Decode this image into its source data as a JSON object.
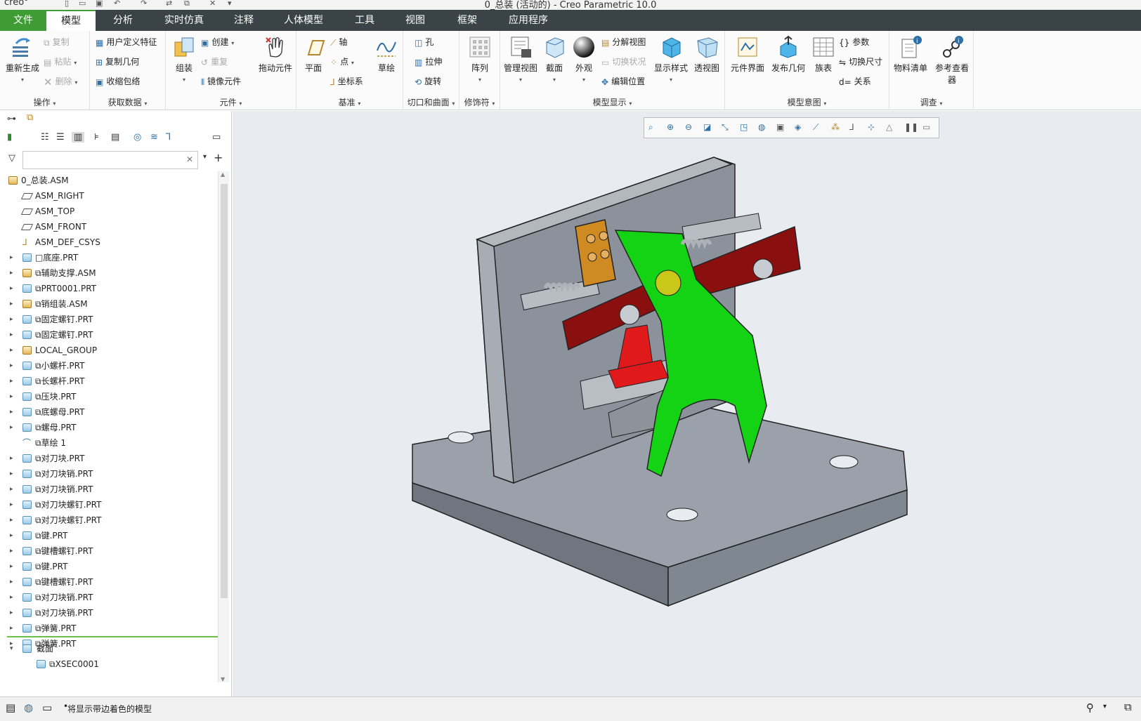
{
  "title": "0_总装 (活动的) - Creo Parametric 10.0",
  "app_logo": "creo°",
  "tabs": [
    "文件",
    "模型",
    "分析",
    "实时仿真",
    "注释",
    "人体模型",
    "工具",
    "视图",
    "框架",
    "应用程序"
  ],
  "ribbon": {
    "operations": {
      "regen": "重新生成",
      "copy": "复制",
      "paste": "粘贴",
      "delete": "删除",
      "title": "操作"
    },
    "get_data": {
      "udf": "用户定义特征",
      "copy_geom": "复制几何",
      "shrinkwrap": "收缩包络",
      "title": "获取数据"
    },
    "component": {
      "assemble": "组装",
      "create": "创建",
      "repeat": "重复",
      "mirror": "镜像元件",
      "drag": "拖动元件",
      "title": "元件"
    },
    "datum": {
      "plane": "平面",
      "axis": "轴",
      "point": "点",
      "csys": "坐标系",
      "sketch": "草绘",
      "title": "基准"
    },
    "cut_surface": {
      "hole": "孔",
      "extrude": "拉伸",
      "revolve": "旋转",
      "title": "切口和曲面"
    },
    "modifiers": {
      "pattern": "阵列",
      "title": "修饰符"
    },
    "model_display": {
      "manage_views": "管理视图",
      "section": "截面",
      "appearance": "外观",
      "explode": "分解视图",
      "toggle_status": "切换状况",
      "edit_position": "编辑位置",
      "display_style": "显示样式",
      "perspective": "透视图",
      "title": "模型显示"
    },
    "model_intent": {
      "comp_interface": "元件界面",
      "publish_geom": "发布几何",
      "family_table": "族表",
      "params": "参数",
      "switch_dims": "切换尺寸",
      "relations": "关系",
      "title": "模型意图"
    },
    "investigate": {
      "bom": "物料清单",
      "ref_viewer": "参考查看器",
      "title": "调查"
    }
  },
  "tree": [
    {
      "label": "0_总装.ASM",
      "icon": "asm-icon",
      "level": 0,
      "expand": ""
    },
    {
      "label": "ASM_RIGHT",
      "icon": "plane-icon",
      "level": 1,
      "expand": ""
    },
    {
      "label": "ASM_TOP",
      "icon": "plane-icon",
      "level": 1,
      "expand": ""
    },
    {
      "label": "ASM_FRONT",
      "icon": "plane-icon",
      "level": 1,
      "expand": ""
    },
    {
      "label": "ASM_DEF_CSYS",
      "icon": "csys-icon",
      "level": 1,
      "expand": ""
    },
    {
      "label": "□底座.PRT",
      "icon": "part-icon",
      "level": 1,
      "expand": "▸"
    },
    {
      "label": "⧉辅助支撑.ASM",
      "icon": "asm-icon",
      "level": 1,
      "expand": "▸"
    },
    {
      "label": "⧉PRT0001.PRT",
      "icon": "part-icon",
      "level": 1,
      "expand": "▸"
    },
    {
      "label": "⧉销组装.ASM",
      "icon": "asm-icon",
      "level": 1,
      "expand": "▸"
    },
    {
      "label": "⧉固定螺钉.PRT",
      "icon": "part-icon",
      "level": 1,
      "expand": "▸"
    },
    {
      "label": "⧉固定螺钉.PRT",
      "icon": "part-icon",
      "level": 1,
      "expand": "▸"
    },
    {
      "label": "LOCAL_GROUP",
      "icon": "group-icon",
      "level": 1,
      "expand": "▸"
    },
    {
      "label": "⧉小螺杆.PRT",
      "icon": "part-icon",
      "level": 1,
      "expand": "▸"
    },
    {
      "label": "⧉长螺杆.PRT",
      "icon": "part-icon",
      "level": 1,
      "expand": "▸"
    },
    {
      "label": "⧉压块.PRT",
      "icon": "part-icon",
      "level": 1,
      "expand": "▸"
    },
    {
      "label": "⧉底螺母.PRT",
      "icon": "part-icon",
      "level": 1,
      "expand": "▸"
    },
    {
      "label": "⧉螺母.PRT",
      "icon": "part-icon",
      "level": 1,
      "expand": "▸"
    },
    {
      "label": "⧉草绘 1",
      "icon": "sketch-icon",
      "level": 1,
      "expand": ""
    },
    {
      "label": "⧉对刀块.PRT",
      "icon": "part-icon",
      "level": 1,
      "expand": "▸"
    },
    {
      "label": "⧉对刀块销.PRT",
      "icon": "part-icon",
      "level": 1,
      "expand": "▸"
    },
    {
      "label": "⧉对刀块销.PRT",
      "icon": "part-icon",
      "level": 1,
      "expand": "▸"
    },
    {
      "label": "⧉对刀块螺钉.PRT",
      "icon": "part-icon",
      "level": 1,
      "expand": "▸"
    },
    {
      "label": "⧉对刀块螺钉.PRT",
      "icon": "part-icon",
      "level": 1,
      "expand": "▸"
    },
    {
      "label": "⧉键.PRT",
      "icon": "part-icon",
      "level": 1,
      "expand": "▸"
    },
    {
      "label": "⧉键槽螺钉.PRT",
      "icon": "part-icon",
      "level": 1,
      "expand": "▸"
    },
    {
      "label": "⧉键.PRT",
      "icon": "part-icon",
      "level": 1,
      "expand": "▸"
    },
    {
      "label": "⧉键槽螺钉.PRT",
      "icon": "part-icon",
      "level": 1,
      "expand": "▸"
    },
    {
      "label": "⧉对刀块销.PRT",
      "icon": "part-icon",
      "level": 1,
      "expand": "▸"
    },
    {
      "label": "⧉对刀块销.PRT",
      "icon": "part-icon",
      "level": 1,
      "expand": "▸"
    },
    {
      "label": "⧉弹簧.PRT",
      "icon": "part-icon",
      "level": 1,
      "expand": "▸"
    },
    {
      "label": "⧉弹簧.PRT",
      "icon": "part-icon",
      "level": 1,
      "expand": "▸"
    }
  ],
  "sections": {
    "label": "截面",
    "child": "⧉XSEC0001"
  },
  "status": {
    "message": "将显示带边着色的模型"
  },
  "colors": {
    "tabbar": "#3a4347",
    "accent": "#3f9b33",
    "base": "#9aa1aa",
    "green": "#14d314",
    "red": "#8a1010",
    "orange": "#d08a22"
  }
}
